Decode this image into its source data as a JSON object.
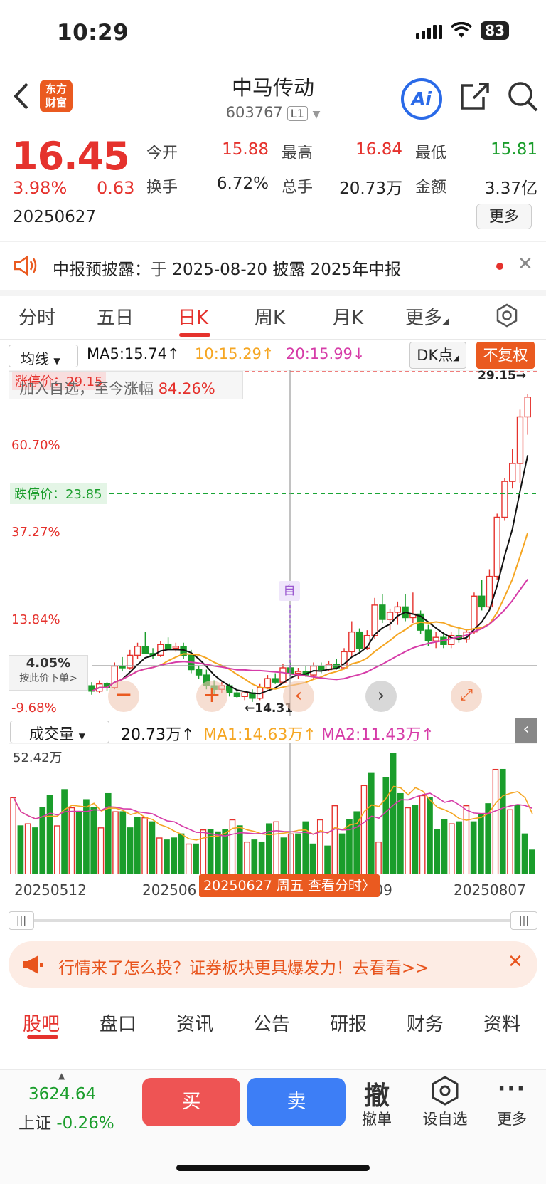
{
  "status_bar": {
    "time": "10:29",
    "battery": "83"
  },
  "header": {
    "logo_line1": "东方",
    "logo_line2": "财富",
    "stock_name": "中马传动",
    "stock_code": "603767",
    "code_tag": "L1",
    "ai_label": "Ai"
  },
  "quote": {
    "price": "16.45",
    "change_pct": "3.98%",
    "change_abs": "0.63",
    "date": "20250627",
    "open_label": "今开",
    "open": "15.88",
    "high_label": "最高",
    "high": "16.84",
    "low_label": "最低",
    "low": "15.81",
    "turnover_label": "换手",
    "turnover": "6.72%",
    "volume_label": "总手",
    "volume": "20.73万",
    "amount_label": "金额",
    "amount": "3.37亿",
    "more_label": "更多"
  },
  "notice": {
    "text": "中报预披露：于 2025-08-20 披露 2025年中报",
    "close": "✕"
  },
  "period_tabs": [
    "分时",
    "五日",
    "日K",
    "周K",
    "月K",
    "更多"
  ],
  "chart_toolbar": {
    "ma_select": "均线",
    "ma5": "MA5:15.74↑",
    "ma10": "10:15.29↑",
    "ma20": "20:15.99↓",
    "dk_label": "DK点",
    "fq_label": "不复权"
  },
  "kline": {
    "limit_up_label": "涨停价：29.15",
    "watch_text": "加入自选，至今涨幅 ",
    "watch_pct": "84.26%",
    "level_60": "60.70%",
    "level_37": "37.27%",
    "level_13": "13.84%",
    "level_neg": "-9.68%",
    "limit_down_label": "跌停价：23.85",
    "max_label": "29.15→",
    "min_label": "←14.31",
    "self_marker": "自",
    "crosshair_pct": "4.05%",
    "crosshair_hint": "按此价下单>"
  },
  "chart_data": {
    "type": "candlestick",
    "candles": [
      [
        12.9,
        13.1,
        12.4,
        12.6
      ],
      [
        12.6,
        13.2,
        12.5,
        13.0
      ],
      [
        13.0,
        13.1,
        12.6,
        12.8
      ],
      [
        12.8,
        14.2,
        12.7,
        14.0
      ],
      [
        14.0,
        14.5,
        13.7,
        13.9
      ],
      [
        13.9,
        14.9,
        13.8,
        14.6
      ],
      [
        14.6,
        15.3,
        14.4,
        15.1
      ],
      [
        15.1,
        15.9,
        14.9,
        14.7
      ],
      [
        14.7,
        15.0,
        14.4,
        14.6
      ],
      [
        14.6,
        15.4,
        14.5,
        15.2
      ],
      [
        15.2,
        15.6,
        14.9,
        15.0
      ],
      [
        15.0,
        15.3,
        14.8,
        15.1
      ],
      [
        15.1,
        15.3,
        14.4,
        14.6
      ],
      [
        14.6,
        14.9,
        13.6,
        13.8
      ],
      [
        13.8,
        14.0,
        13.3,
        13.5
      ],
      [
        13.5,
        13.8,
        12.7,
        12.9
      ],
      [
        12.9,
        13.2,
        12.4,
        12.7
      ],
      [
        12.7,
        13.1,
        12.5,
        12.9
      ],
      [
        12.9,
        13.0,
        12.3,
        12.5
      ],
      [
        12.5,
        12.7,
        12.2,
        12.3
      ],
      [
        12.3,
        12.6,
        12.1,
        12.5
      ],
      [
        12.5,
        12.7,
        12.0,
        12.2
      ],
      [
        12.2,
        13.0,
        12.1,
        12.8
      ],
      [
        12.8,
        13.5,
        12.7,
        13.3
      ],
      [
        13.3,
        13.6,
        13.0,
        13.1
      ],
      [
        13.1,
        14.1,
        13.0,
        13.9
      ],
      [
        13.9,
        14.2,
        13.4,
        13.6
      ],
      [
        13.6,
        13.9,
        13.3,
        13.7
      ],
      [
        13.7,
        14.0,
        13.4,
        13.5
      ],
      [
        13.5,
        14.2,
        13.3,
        14.0
      ],
      [
        14.0,
        14.2,
        13.6,
        13.8
      ],
      [
        13.8,
        14.3,
        13.7,
        14.1
      ],
      [
        14.1,
        14.4,
        13.8,
        13.9
      ],
      [
        13.9,
        15.0,
        13.8,
        14.8
      ],
      [
        14.8,
        16.5,
        14.5,
        15.9
      ],
      [
        15.9,
        16.1,
        14.8,
        15.0
      ],
      [
        15.0,
        16.0,
        14.9,
        15.7
      ],
      [
        15.7,
        17.8,
        15.5,
        17.4
      ],
      [
        17.4,
        18.0,
        16.4,
        16.6
      ],
      [
        16.6,
        17.2,
        16.0,
        17.0
      ],
      [
        17.0,
        17.6,
        16.3,
        17.3
      ],
      [
        17.3,
        18.0,
        16.5,
        16.7
      ],
      [
        16.7,
        18.1,
        16.4,
        16.9
      ],
      [
        16.9,
        17.1,
        15.8,
        16.0
      ],
      [
        16.0,
        16.3,
        15.1,
        15.4
      ],
      [
        15.4,
        15.9,
        15.0,
        15.6
      ],
      [
        15.6,
        15.9,
        15.0,
        15.2
      ],
      [
        15.2,
        15.9,
        15.0,
        15.7
      ],
      [
        15.7,
        16.1,
        15.3,
        15.5
      ],
      [
        15.5,
        16.0,
        15.3,
        15.9
      ],
      [
        15.9,
        18.1,
        15.8,
        17.9
      ],
      [
        17.9,
        18.8,
        17.1,
        17.3
      ],
      [
        17.3,
        19.4,
        17.2,
        19.0
      ],
      [
        19.0,
        22.5,
        18.8,
        22.3
      ],
      [
        22.3,
        24.5,
        22.1,
        24.3
      ],
      [
        24.3,
        26.1,
        23.9,
        25.3
      ],
      [
        25.3,
        28.3,
        24.2,
        27.9
      ],
      [
        27.9,
        29.15,
        26.9,
        29.0
      ]
    ],
    "volume": [
      38,
      24,
      25,
      23,
      33,
      39,
      24,
      42,
      33,
      31,
      37,
      33,
      23,
      40,
      31,
      31,
      23,
      28,
      28,
      26,
      18,
      17,
      18,
      20,
      15,
      15,
      22,
      22,
      21,
      22,
      27,
      24,
      16,
      17,
      16,
      25,
      26,
      18,
      20,
      20,
      26,
      15,
      27,
      14,
      34,
      20,
      27,
      31,
      44,
      50,
      16,
      48,
      60,
      40,
      33,
      34,
      39,
      38,
      22,
      27,
      25,
      26,
      34,
      26,
      30,
      35,
      52,
      52,
      32,
      34,
      20,
      12
    ],
    "ylim_price": [
      11.2,
      30.5
    ],
    "volume_max_label": "52.42万",
    "x_dates": [
      "20250512",
      "20250610",
      "20250709",
      "20250807"
    ]
  },
  "volume_panel": {
    "select": "成交量",
    "vol": "20.73万↑",
    "ma1": "MA1:14.63万↑",
    "ma2": "MA2:11.43万↑",
    "collapse": "‹"
  },
  "date_labels": [
    "20250512",
    "202506",
    "20250709",
    "20250807"
  ],
  "date_tip": "20250627 周五 查看分时〉",
  "promo": {
    "text": "行情来了怎么投？证券板块更具爆发力！去看看>>",
    "close": "✕"
  },
  "bottom_tabs": [
    "股吧",
    "盘口",
    "资讯",
    "公告",
    "研报",
    "财务",
    "资料"
  ],
  "action_bar": {
    "index_value": "3624.64",
    "index_name": "上证",
    "index_change": "-0.26%",
    "buy": "买",
    "sell": "卖",
    "cancel_icon": "撤",
    "cancel": "撤单",
    "watch": "设自选",
    "more": "更多"
  },
  "colors": {
    "up": "#e5322d",
    "down": "#1a9d2b",
    "accent": "#ea5a20",
    "ma5": "#111111",
    "ma10": "#f5a623",
    "ma20": "#d63ca8"
  }
}
